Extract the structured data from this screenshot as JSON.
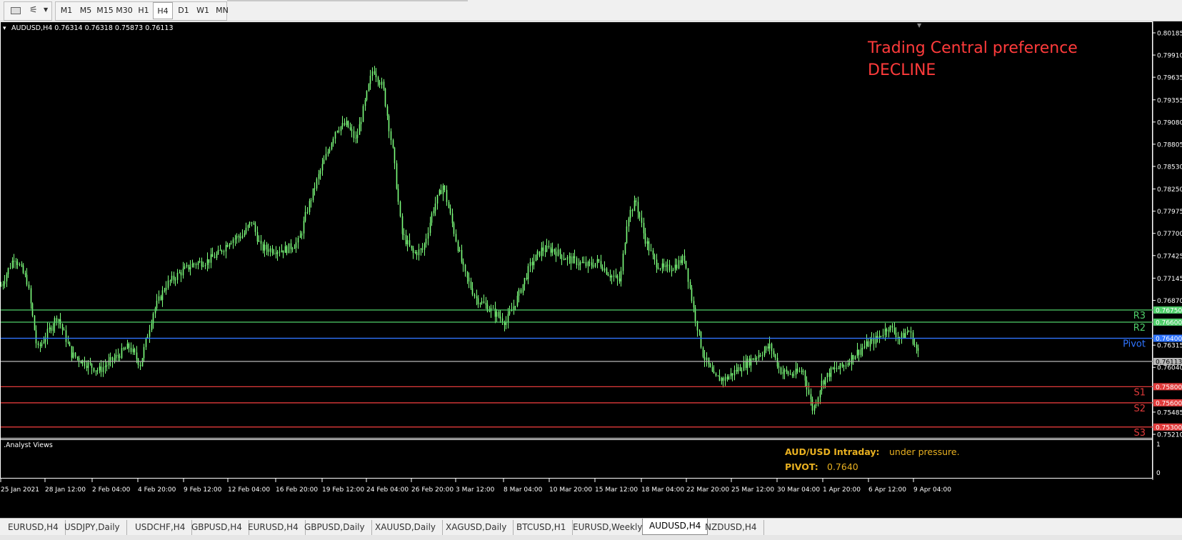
{
  "toolbar": {
    "timeframes": [
      "M1",
      "M5",
      "M15",
      "M30",
      "H1",
      "H4",
      "D1",
      "W1",
      "MN"
    ],
    "active_timeframe": "H4"
  },
  "chart": {
    "header": "AUDUSD,H4  0.76314 0.76318 0.75873 0.76113",
    "preference_line1": "Trading Central preference",
    "preference_line2": "DECLINE",
    "price_scale": [
      "0.80185",
      "0.79910",
      "0.79635",
      "0.79355",
      "0.79080",
      "0.78805",
      "0.78530",
      "0.78250",
      "0.77975",
      "0.77700",
      "0.77425",
      "0.77145",
      "0.76870",
      "0.76315",
      "0.76040",
      "0.75485",
      "0.75210"
    ],
    "levels": [
      {
        "name": "R3",
        "value": "0.76750",
        "color": "#4fcf6a"
      },
      {
        "name": "R2",
        "value": "0.76600",
        "color": "#4fcf6a"
      },
      {
        "name": "Pivot",
        "value": "0.76400",
        "color": "#2f74ff"
      },
      {
        "name": "",
        "value": "0.76113",
        "color": "#b8b8b8"
      },
      {
        "name": "S1",
        "value": "0.75800",
        "color": "#e03a3a"
      },
      {
        "name": "S2",
        "value": "0.75600",
        "color": "#e03a3a"
      },
      {
        "name": "S3",
        "value": "0.75300",
        "color": "#e03a3a"
      }
    ],
    "time_labels": [
      "25 Jan 2021",
      "28 Jan 12:00",
      "2 Feb 04:00",
      "4 Feb 20:00",
      "9 Feb 12:00",
      "12 Feb 04:00",
      "16 Feb 20:00",
      "19 Feb 12:00",
      "24 Feb 04:00",
      "26 Feb 20:00",
      "3 Mar 12:00",
      "8 Mar 04:00",
      "10 Mar 20:00",
      "15 Mar 12:00",
      "18 Mar 04:00",
      "22 Mar 20:00",
      "25 Mar 12:00",
      "30 Mar 04:00",
      "1 Apr 20:00",
      "6 Apr 12:00",
      "9 Apr 04:00"
    ],
    "candle_color": "#7dff7d",
    "background": "#000000",
    "sub_window": {
      "title": ".Analyst Views",
      "label1": "AUD/USD Intraday:",
      "value1": "under pressure.",
      "label2": "PIVOT:",
      "value2": "0.7640",
      "label_color": "#e8b020",
      "scale_top": "1",
      "scale_bottom": "0"
    }
  },
  "tabs": [
    "EURUSD,H4",
    "USDJPY,Daily",
    "USDCHF,H4",
    "GBPUSD,H4",
    "EURUSD,H4",
    "GBPUSD,Daily",
    "XAUUSD,Daily",
    "XAGUSD,Daily",
    "BTCUSD,H1",
    "EURUSD,Weekly",
    "AUDUSD,H4",
    "NZDUSD,H4"
  ],
  "active_tab": "AUDUSD,H4"
}
